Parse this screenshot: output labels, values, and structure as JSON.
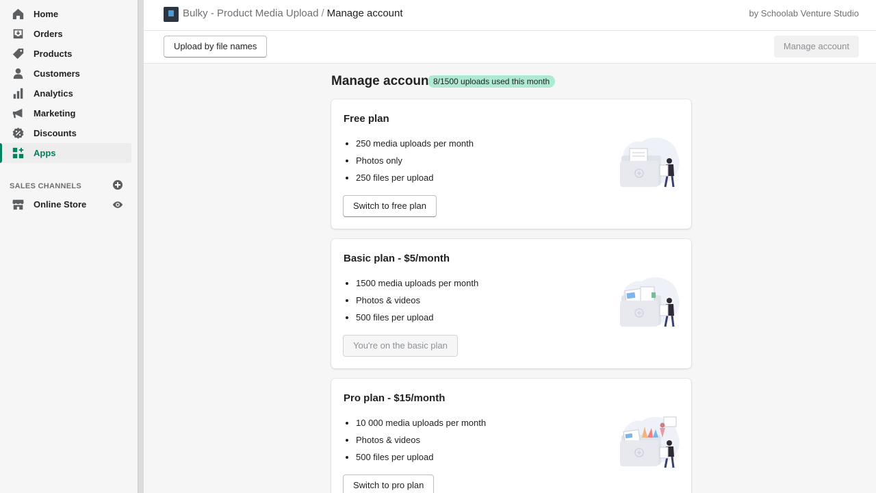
{
  "sidebar": {
    "items": [
      {
        "label": "Home",
        "icon": "home-icon"
      },
      {
        "label": "Orders",
        "icon": "orders-icon"
      },
      {
        "label": "Products",
        "icon": "tag-icon"
      },
      {
        "label": "Customers",
        "icon": "person-icon"
      },
      {
        "label": "Analytics",
        "icon": "bar-chart-icon"
      },
      {
        "label": "Marketing",
        "icon": "megaphone-icon"
      },
      {
        "label": "Discounts",
        "icon": "discount-icon"
      },
      {
        "label": "Apps",
        "icon": "apps-icon",
        "active": true
      }
    ],
    "channels_label": "SALES CHANNELS",
    "online_store": "Online Store"
  },
  "header": {
    "app_name": "Bulky - Product Media Upload",
    "separator": "/",
    "current": "Manage account",
    "byline": "by Schoolab Venture Studio"
  },
  "toolbar": {
    "upload_label": "Upload by file names",
    "manage_label": "Manage account"
  },
  "main": {
    "title": "Manage account",
    "usage_badge": "8/1500 uploads used this month",
    "plans": [
      {
        "title": "Free plan",
        "features": [
          "250 media uploads per month",
          "Photos only",
          "250 files per upload"
        ],
        "button": "Switch to free plan",
        "disabled": false
      },
      {
        "title": "Basic plan - $5/month",
        "features": [
          "1500 media uploads per month",
          "Photos & videos",
          "500 files per upload"
        ],
        "button": "You're on the basic plan",
        "disabled": true
      },
      {
        "title": "Pro plan - $15/month",
        "features": [
          "10 000 media uploads per month",
          "Photos & videos",
          "500 files per upload"
        ],
        "button": "Switch to pro plan",
        "disabled": false
      }
    ]
  },
  "colors": {
    "accent": "#008060",
    "badge": "#aee9d1",
    "icon": "#5c5f62"
  }
}
